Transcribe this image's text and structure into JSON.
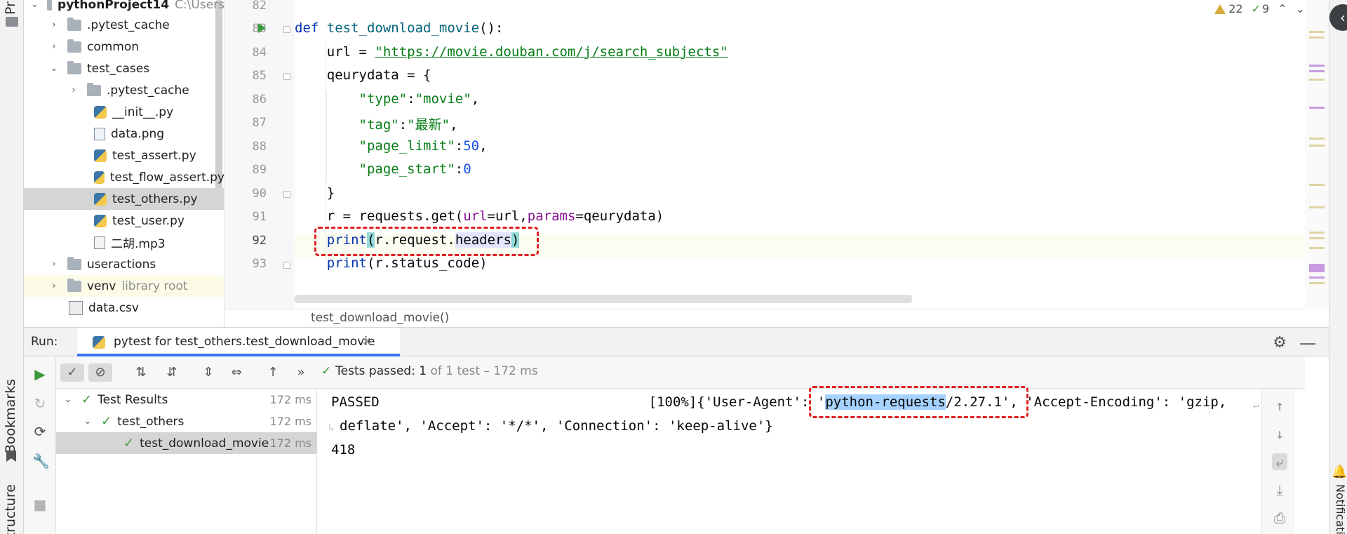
{
  "left_strip": {
    "tabs": [
      "Pr",
      "Bookmarks",
      "Structure"
    ]
  },
  "right_strip": {
    "tabs": [
      "Notifications"
    ]
  },
  "project_tree": {
    "items": [
      {
        "label": "pythonProject14",
        "extra": "C:\\Users",
        "depth": 0,
        "kind": "folder",
        "expanded": true,
        "bold": true
      },
      {
        "label": ".pytest_cache",
        "depth": 1,
        "kind": "folder",
        "expanded": false
      },
      {
        "label": "common",
        "depth": 1,
        "kind": "folder",
        "expanded": false
      },
      {
        "label": "test_cases",
        "depth": 1,
        "kind": "folder",
        "expanded": true
      },
      {
        "label": ".pytest_cache",
        "depth": 2,
        "kind": "folder",
        "expanded": false
      },
      {
        "label": "__init__.py",
        "depth": 2,
        "kind": "py"
      },
      {
        "label": "data.png",
        "depth": 2,
        "kind": "png"
      },
      {
        "label": "test_assert.py",
        "depth": 2,
        "kind": "py"
      },
      {
        "label": "test_flow_assert.py",
        "depth": 2,
        "kind": "py"
      },
      {
        "label": "test_others.py",
        "depth": 2,
        "kind": "py",
        "selected": true
      },
      {
        "label": "test_user.py",
        "depth": 2,
        "kind": "py"
      },
      {
        "label": "二胡.mp3",
        "depth": 2,
        "kind": "mp3"
      },
      {
        "label": "useractions",
        "depth": 1,
        "kind": "folder",
        "expanded": false
      },
      {
        "label": "venv",
        "extra": "library root",
        "depth": 1,
        "kind": "folder",
        "expanded": false,
        "venv": true
      },
      {
        "label": "data.csv",
        "depth": 1,
        "kind": "csv"
      }
    ]
  },
  "editor": {
    "inspections": {
      "warnings": "22",
      "ok": "9"
    },
    "line_numbers": [
      "82",
      "83",
      "84",
      "85",
      "86",
      "87",
      "88",
      "89",
      "90",
      "91",
      "92",
      "93"
    ],
    "current_line": "92",
    "breadcrumb": "test_download_movie()",
    "code": {
      "l83_def": "def ",
      "l83_name": "test_download_movie",
      "l83_rest": "():",
      "l84_a": "    url = ",
      "l84_url": "\"https://movie.douban.com/j/search_subjects\"",
      "l85": "    qeurydata = {",
      "l86_key": "        \"type\"",
      "l86_val": "\"movie\"",
      "l87_key": "        \"tag\"",
      "l87_val": "\"最新\"",
      "l88_key": "        \"page_limit\"",
      "l88_val": "50",
      "l89_key": "        \"page_start\"",
      "l89_val": "0",
      "l90": "    }",
      "l91_a": "    r = requests.get(",
      "l91_p1": "url",
      "l91_b": "=url,",
      "l91_p2": "params",
      "l91_c": "=qeurydata)",
      "l92_indent": "    ",
      "l92_print": "print",
      "l92_open": "(",
      "l92_mid": "r.request.",
      "l92_headers": "headers",
      "l92_close": ")",
      "l93_indent": "    ",
      "l93_print": "print",
      "l93_rest": "(r.status_code)"
    }
  },
  "run_panel": {
    "label": "Run:",
    "tab_title": "pytest for test_others.test_download_movie",
    "status": {
      "prefix": "Tests passed: ",
      "passed": "1",
      "suffix": " of 1 test – 172 ms"
    },
    "results": [
      {
        "label": "Test Results",
        "time": "172 ms",
        "depth": 0
      },
      {
        "label": "test_others",
        "time": "172 ms",
        "depth": 1
      },
      {
        "label": "test_download_movie",
        "time": "172 ms",
        "depth": 2,
        "selected": true
      }
    ],
    "console": {
      "line1_a": "PASSED",
      "line1_b": "[100%]{'User-Agent': ",
      "line1_ua_q": "'",
      "line1_ua_sel": "python-requests",
      "line1_ua_rest": "/2.27.1'",
      "line1_c": ", 'Accept-Encoding': 'gzip, ",
      "line2": "deflate', 'Accept': '*/*', 'Connection': 'keep-alive'}",
      "line3": "418"
    }
  },
  "colors": {
    "accent": "#3574f0",
    "highlight_box": "#e02020",
    "pass_green": "#3c9a3c",
    "selection": "#a6d2ff"
  }
}
